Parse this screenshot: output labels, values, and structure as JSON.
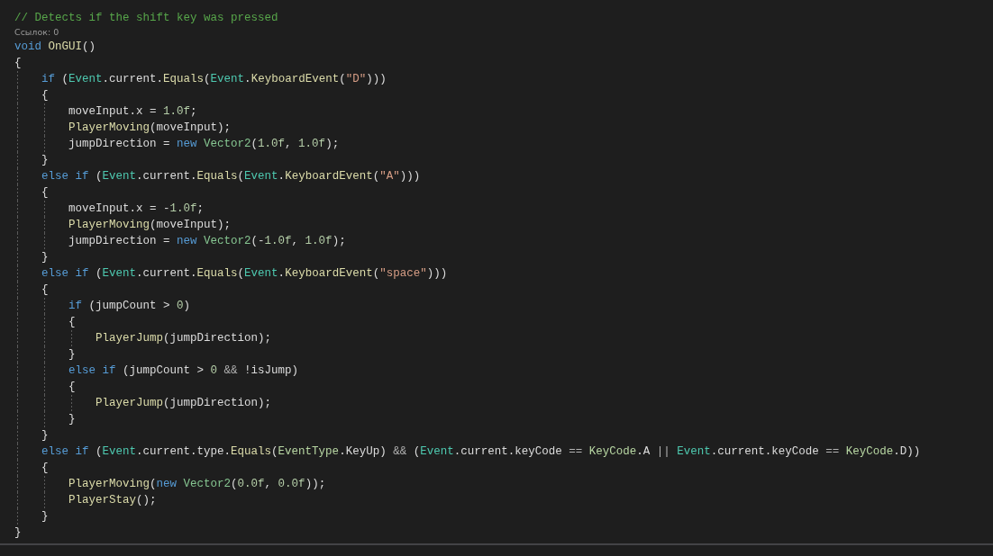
{
  "editor": {
    "lines": [
      {
        "kind": "code",
        "tokens": [
          {
            "text": "// Detects if the shift key was pressed",
            "kind": "comment"
          }
        ]
      },
      {
        "kind": "codelens",
        "text": "Ссылок: 0"
      },
      {
        "kind": "code",
        "tokens": [
          {
            "text": "void ",
            "kind": "keyword"
          },
          {
            "text": "OnGUI",
            "kind": "method"
          },
          {
            "text": "()",
            "kind": "plain"
          }
        ]
      },
      {
        "kind": "code",
        "tokens": [
          {
            "text": "{",
            "kind": "plain"
          }
        ]
      },
      {
        "kind": "code",
        "tokens": [
          {
            "text": "    if",
            "kind": "keyword"
          },
          {
            "text": " (",
            "kind": "plain"
          },
          {
            "text": "Event",
            "kind": "class"
          },
          {
            "text": ".current.",
            "kind": "plain"
          },
          {
            "text": "Equals",
            "kind": "method"
          },
          {
            "text": "(",
            "kind": "plain"
          },
          {
            "text": "Event",
            "kind": "class"
          },
          {
            "text": ".",
            "kind": "plain"
          },
          {
            "text": "KeyboardEvent",
            "kind": "method"
          },
          {
            "text": "(",
            "kind": "plain"
          },
          {
            "text": "\"D\"",
            "kind": "string"
          },
          {
            "text": ")))",
            "kind": "plain"
          }
        ]
      },
      {
        "kind": "code",
        "tokens": [
          {
            "text": "    {",
            "kind": "plain"
          }
        ]
      },
      {
        "kind": "code",
        "tokens": [
          {
            "text": "        moveInput.x = ",
            "kind": "plain"
          },
          {
            "text": "1.0f",
            "kind": "number"
          },
          {
            "text": ";",
            "kind": "plain"
          }
        ]
      },
      {
        "kind": "code",
        "tokens": [
          {
            "text": "        PlayerMoving",
            "kind": "method"
          },
          {
            "text": "(moveInput);",
            "kind": "plain"
          }
        ]
      },
      {
        "kind": "code",
        "tokens": [
          {
            "text": "        jumpDirection = ",
            "kind": "plain"
          },
          {
            "text": "new ",
            "kind": "keyword"
          },
          {
            "text": "Vector2",
            "kind": "struct"
          },
          {
            "text": "(",
            "kind": "plain"
          },
          {
            "text": "1.0f",
            "kind": "number"
          },
          {
            "text": ", ",
            "kind": "plain"
          },
          {
            "text": "1.0f",
            "kind": "number"
          },
          {
            "text": ");",
            "kind": "plain"
          }
        ]
      },
      {
        "kind": "code",
        "tokens": [
          {
            "text": "    }",
            "kind": "plain"
          }
        ]
      },
      {
        "kind": "code",
        "tokens": [
          {
            "text": "    else if",
            "kind": "keyword"
          },
          {
            "text": " (",
            "kind": "plain"
          },
          {
            "text": "Event",
            "kind": "class"
          },
          {
            "text": ".current.",
            "kind": "plain"
          },
          {
            "text": "Equals",
            "kind": "method"
          },
          {
            "text": "(",
            "kind": "plain"
          },
          {
            "text": "Event",
            "kind": "class"
          },
          {
            "text": ".",
            "kind": "plain"
          },
          {
            "text": "KeyboardEvent",
            "kind": "method"
          },
          {
            "text": "(",
            "kind": "plain"
          },
          {
            "text": "\"A\"",
            "kind": "string"
          },
          {
            "text": ")))",
            "kind": "plain"
          }
        ]
      },
      {
        "kind": "code",
        "tokens": [
          {
            "text": "    {",
            "kind": "plain"
          }
        ]
      },
      {
        "kind": "code",
        "tokens": [
          {
            "text": "        moveInput.x = -",
            "kind": "plain"
          },
          {
            "text": "1.0f",
            "kind": "number"
          },
          {
            "text": ";",
            "kind": "plain"
          }
        ]
      },
      {
        "kind": "code",
        "tokens": [
          {
            "text": "        PlayerMoving",
            "kind": "method"
          },
          {
            "text": "(moveInput);",
            "kind": "plain"
          }
        ]
      },
      {
        "kind": "code",
        "tokens": [
          {
            "text": "        jumpDirection = ",
            "kind": "plain"
          },
          {
            "text": "new ",
            "kind": "keyword"
          },
          {
            "text": "Vector2",
            "kind": "struct"
          },
          {
            "text": "(-",
            "kind": "plain"
          },
          {
            "text": "1.0f",
            "kind": "number"
          },
          {
            "text": ", ",
            "kind": "plain"
          },
          {
            "text": "1.0f",
            "kind": "number"
          },
          {
            "text": ");",
            "kind": "plain"
          }
        ]
      },
      {
        "kind": "code",
        "tokens": [
          {
            "text": "    }",
            "kind": "plain"
          }
        ]
      },
      {
        "kind": "code",
        "tokens": [
          {
            "text": "    else if",
            "kind": "keyword"
          },
          {
            "text": " (",
            "kind": "plain"
          },
          {
            "text": "Event",
            "kind": "class"
          },
          {
            "text": ".current.",
            "kind": "plain"
          },
          {
            "text": "Equals",
            "kind": "method"
          },
          {
            "text": "(",
            "kind": "plain"
          },
          {
            "text": "Event",
            "kind": "class"
          },
          {
            "text": ".",
            "kind": "plain"
          },
          {
            "text": "KeyboardEvent",
            "kind": "method"
          },
          {
            "text": "(",
            "kind": "plain"
          },
          {
            "text": "\"space\"",
            "kind": "string"
          },
          {
            "text": ")))",
            "kind": "plain"
          }
        ]
      },
      {
        "kind": "code",
        "tokens": [
          {
            "text": "    {",
            "kind": "plain"
          }
        ]
      },
      {
        "kind": "code",
        "tokens": [
          {
            "text": "        if",
            "kind": "keyword"
          },
          {
            "text": " (jumpCount > ",
            "kind": "plain"
          },
          {
            "text": "0",
            "kind": "number"
          },
          {
            "text": ")",
            "kind": "plain"
          }
        ]
      },
      {
        "kind": "code",
        "tokens": [
          {
            "text": "        {",
            "kind": "plain"
          }
        ]
      },
      {
        "kind": "code",
        "tokens": [
          {
            "text": "            PlayerJump",
            "kind": "method"
          },
          {
            "text": "(jumpDirection);",
            "kind": "plain"
          }
        ]
      },
      {
        "kind": "code",
        "tokens": [
          {
            "text": "        }",
            "kind": "plain"
          }
        ]
      },
      {
        "kind": "code",
        "tokens": [
          {
            "text": "        else if",
            "kind": "keyword"
          },
          {
            "text": " (jumpCount > ",
            "kind": "plain"
          },
          {
            "text": "0",
            "kind": "number"
          },
          {
            "text": " &&",
            "kind": "operator"
          },
          {
            "text": " !isJump)",
            "kind": "plain"
          }
        ]
      },
      {
        "kind": "code",
        "tokens": [
          {
            "text": "        {",
            "kind": "plain"
          }
        ]
      },
      {
        "kind": "code",
        "tokens": [
          {
            "text": "            PlayerJump",
            "kind": "method"
          },
          {
            "text": "(jumpDirection);",
            "kind": "plain"
          }
        ]
      },
      {
        "kind": "code",
        "tokens": [
          {
            "text": "        }",
            "kind": "plain"
          }
        ]
      },
      {
        "kind": "code",
        "tokens": [
          {
            "text": "    }",
            "kind": "plain"
          }
        ]
      },
      {
        "kind": "code",
        "tokens": [
          {
            "text": "    else if",
            "kind": "keyword"
          },
          {
            "text": " (",
            "kind": "plain"
          },
          {
            "text": "Event",
            "kind": "class"
          },
          {
            "text": ".current.type.",
            "kind": "plain"
          },
          {
            "text": "Equals",
            "kind": "method"
          },
          {
            "text": "(",
            "kind": "plain"
          },
          {
            "text": "EventType",
            "kind": "enum"
          },
          {
            "text": ".KeyUp) ",
            "kind": "plain"
          },
          {
            "text": "&&",
            "kind": "operator"
          },
          {
            "text": " (",
            "kind": "plain"
          },
          {
            "text": "Event",
            "kind": "class"
          },
          {
            "text": ".current.keyCode ",
            "kind": "plain"
          },
          {
            "text": "== ",
            "kind": "operator"
          },
          {
            "text": "KeyCode",
            "kind": "enum"
          },
          {
            "text": ".A ",
            "kind": "plain"
          },
          {
            "text": "|| ",
            "kind": "operator"
          },
          {
            "text": "Event",
            "kind": "class"
          },
          {
            "text": ".current.keyCode ",
            "kind": "plain"
          },
          {
            "text": "== ",
            "kind": "operator"
          },
          {
            "text": "KeyCode",
            "kind": "enum"
          },
          {
            "text": ".D))",
            "kind": "plain"
          }
        ]
      },
      {
        "kind": "code",
        "tokens": [
          {
            "text": "    {",
            "kind": "plain"
          }
        ]
      },
      {
        "kind": "code",
        "tokens": [
          {
            "text": "        PlayerMoving",
            "kind": "method"
          },
          {
            "text": "(",
            "kind": "plain"
          },
          {
            "text": "new ",
            "kind": "keyword"
          },
          {
            "text": "Vector2",
            "kind": "struct"
          },
          {
            "text": "(",
            "kind": "plain"
          },
          {
            "text": "0.0f",
            "kind": "number"
          },
          {
            "text": ", ",
            "kind": "plain"
          },
          {
            "text": "0.0f",
            "kind": "number"
          },
          {
            "text": "));",
            "kind": "plain"
          }
        ]
      },
      {
        "kind": "code",
        "tokens": [
          {
            "text": "        PlayerStay",
            "kind": "method"
          },
          {
            "text": "();",
            "kind": "plain"
          }
        ]
      },
      {
        "kind": "code",
        "tokens": [
          {
            "text": "    }",
            "kind": "plain"
          }
        ]
      },
      {
        "kind": "code",
        "tokens": [
          {
            "text": "}",
            "kind": "plain"
          }
        ]
      }
    ]
  }
}
